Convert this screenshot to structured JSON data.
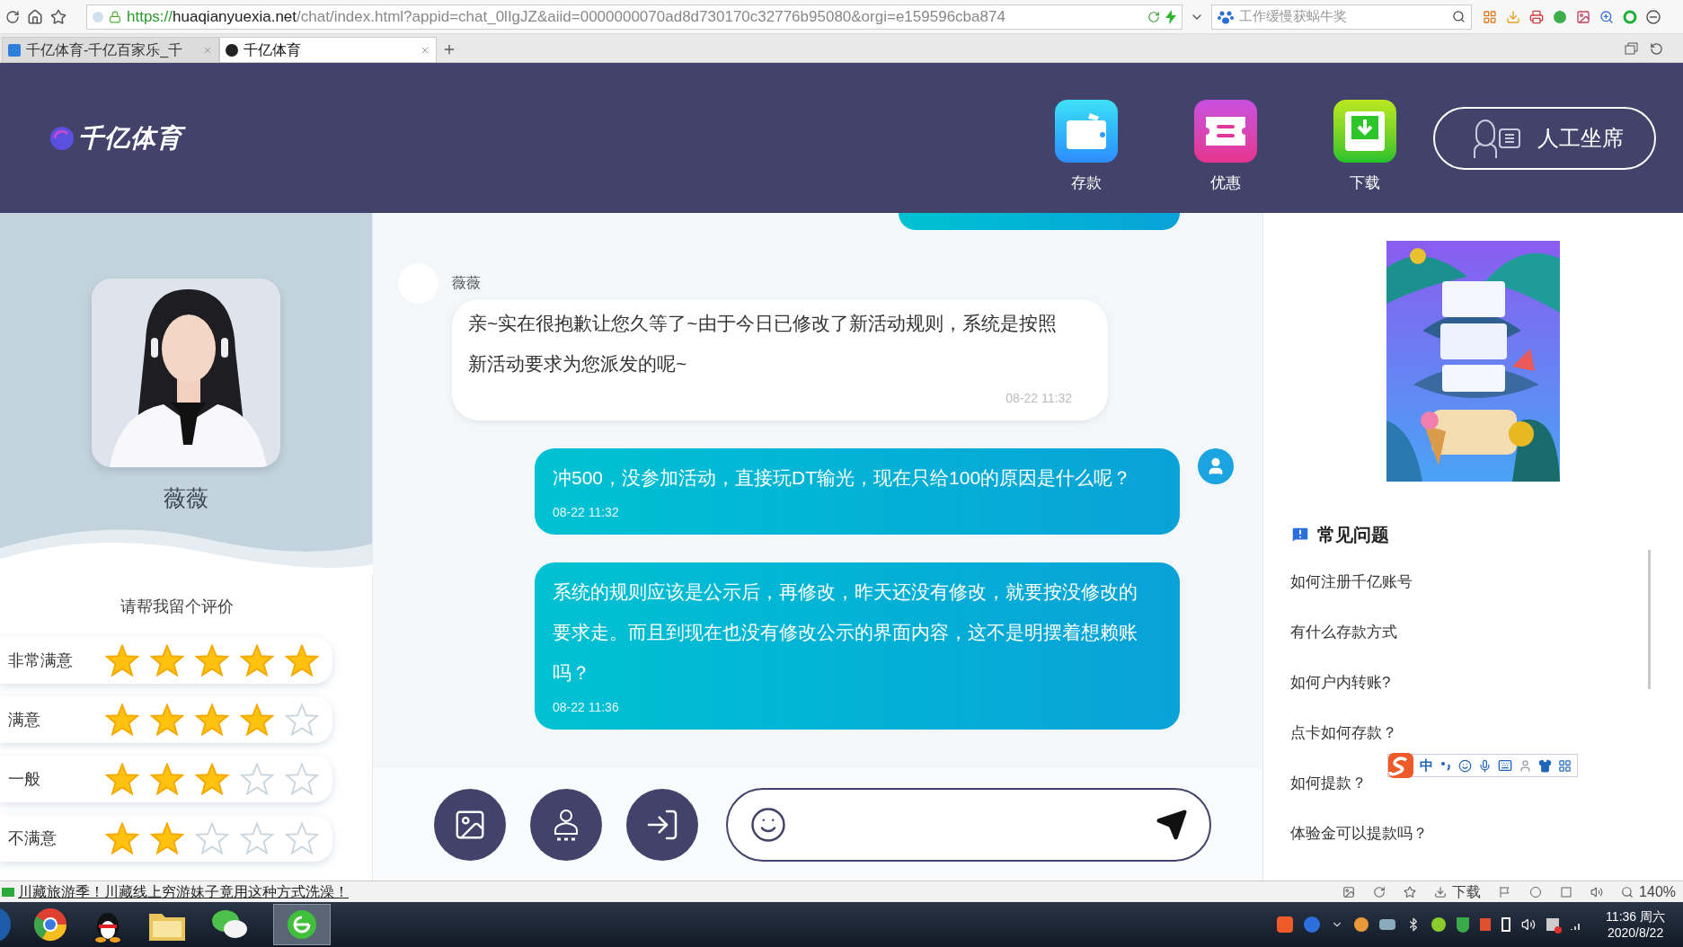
{
  "browser": {
    "url_scheme": "https://",
    "url_domain": "huaqianyuexia.net",
    "url_path": "/chat/index.html?appid=chat_0lIgJZ&aiid=0000000070ad8d730170c32776b95080&orgi=e159596cba874",
    "search_placeholder": "工作缓慢获蜗牛奖",
    "tabs": [
      {
        "title": "千亿体育-千亿百家乐_千",
        "selected": false
      },
      {
        "title": "千亿体育",
        "selected": true
      }
    ]
  },
  "header": {
    "logo": "千亿体育",
    "nav": [
      {
        "label": "存款",
        "kind": "wallet"
      },
      {
        "label": "优惠",
        "kind": "ticket"
      },
      {
        "label": "下载",
        "kind": "download"
      }
    ],
    "agent_button": "人工坐席"
  },
  "profile": {
    "name": "薇薇",
    "rating_prompt": "请帮我留个评价",
    "ratings": [
      {
        "label": "非常满意",
        "stars": 5
      },
      {
        "label": "满意",
        "stars": 4
      },
      {
        "label": "一般",
        "stars": 3
      },
      {
        "label": "不满意",
        "stars": 2
      }
    ]
  },
  "chat": {
    "messages": [
      {
        "kind": "cut"
      },
      {
        "kind": "agent",
        "name": "薇薇",
        "text": "亲~实在很抱歉让您久等了~由于今日已修改了新活动规则，系统是按照新活动要求为您派发的呢~",
        "time": "08-22 11:32"
      },
      {
        "kind": "user",
        "avatar": true,
        "text": "冲500，没参加活动，直接玩DT输光，现在只给100的原因是什么呢？",
        "time": "08-22 11:32"
      },
      {
        "kind": "user",
        "avatar": false,
        "text": "系统的规则应该是公示后，再修改，昨天还没有修改，就要按没修改的要求走。而且到现在也没有修改公示的界面内容，这不是明摆着想赖账吗？",
        "time": "08-22 11:36"
      }
    ]
  },
  "faq": {
    "title": "常见问题",
    "items": [
      "如何注册千亿账号",
      "有什么存款方式",
      "如何户内转账?",
      "点卡如何存款？",
      "如何提款？",
      "体验金可以提款吗？"
    ]
  },
  "ime_toolbar": {
    "mode": "中"
  },
  "status_bar": {
    "news": "川藏旅游季！川藏线上穷游妹子竟用这种方式洗澡！",
    "download": "下载",
    "zoom": "140%"
  },
  "taskbar": {
    "time": "11:36 周六",
    "date": "2020/8/22"
  }
}
